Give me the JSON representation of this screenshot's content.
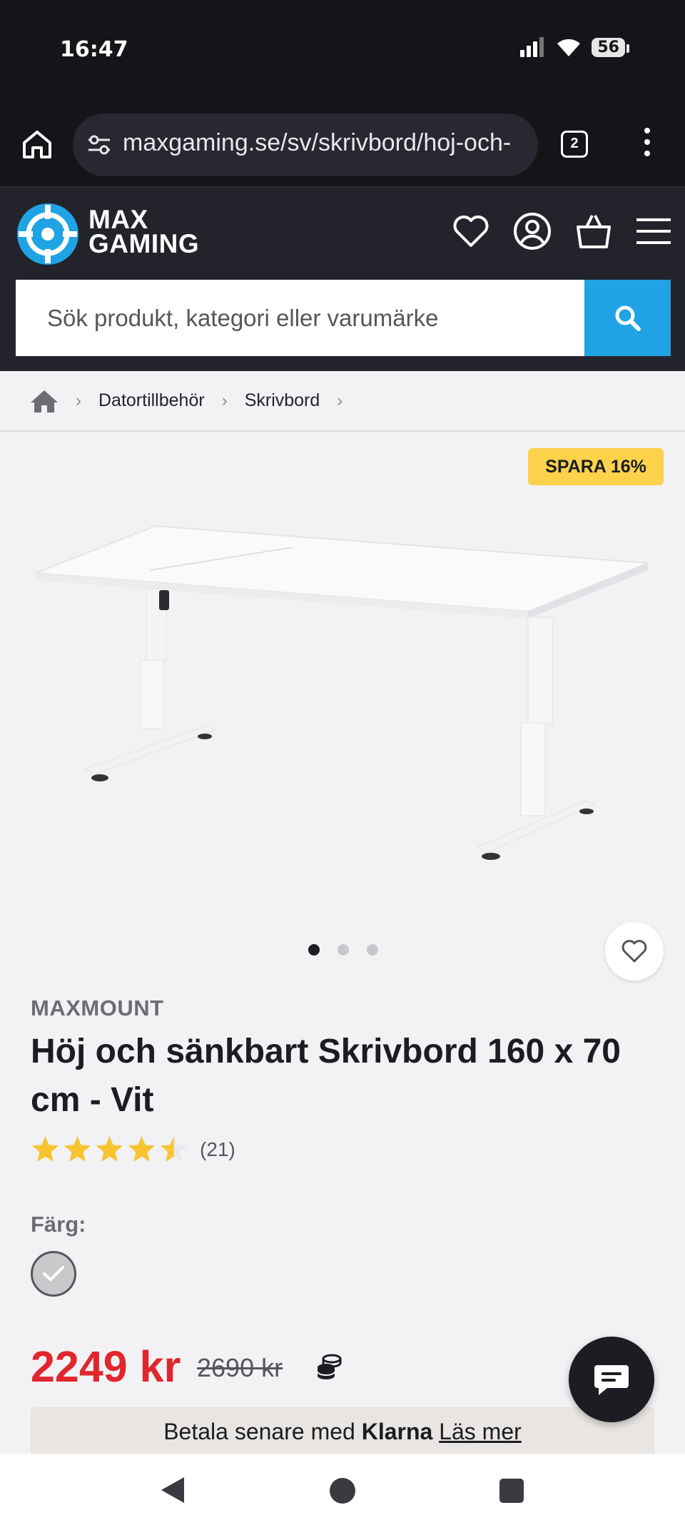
{
  "status_bar": {
    "time": "16:47",
    "battery": "56"
  },
  "browser": {
    "url": "maxgaming.se/sv/skrivbord/hoj-och-",
    "tab_count": "2"
  },
  "site": {
    "logo_line1": "MAX",
    "logo_line2": "GAMING",
    "search_placeholder": "Sök produkt, kategori eller varumärke"
  },
  "breadcrumb": {
    "items": [
      "Datortillbehör",
      "Skrivbord"
    ]
  },
  "product": {
    "badge": "SPARA 16%",
    "brand": "MAXMOUNT",
    "title": "Höj och sänkbart Skrivbord 160 x 70 cm - Vit",
    "rating_value": 4.5,
    "rating_count": "(21)",
    "color_label": "Färg:",
    "price": "2249 kr",
    "old_price": "2690 kr",
    "gallery_images": 3,
    "gallery_active": 1
  },
  "klarna": {
    "prefix": "Betala senare med",
    "brand": "Klarna",
    "link": "Läs mer"
  },
  "colors": {
    "accent": "#1fa3e4",
    "price": "#e1262d",
    "badge": "#fbd24a",
    "header": "#23242b"
  }
}
